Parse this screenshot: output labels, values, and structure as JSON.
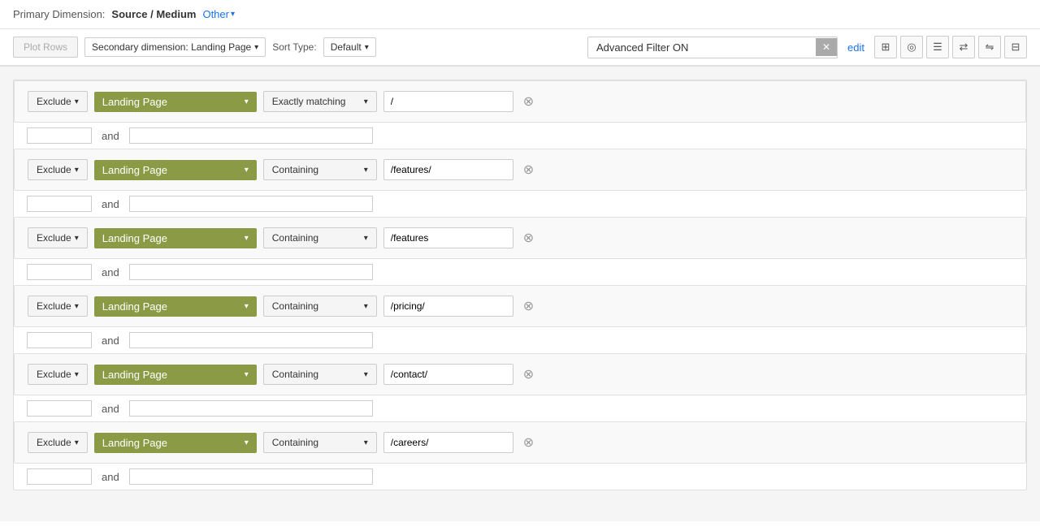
{
  "topBar": {
    "primaryDimensionLabel": "Primary Dimension:",
    "sourceMedium": "Source / Medium",
    "otherLabel": "Other",
    "chevron": "▾"
  },
  "toolbar": {
    "plotRowsLabel": "Plot Rows",
    "secondaryDimension": "Secondary dimension: Landing Page",
    "sortTypeLabel": "Sort Type:",
    "sortDefault": "Default",
    "filterValue": "Advanced Filter ON",
    "filterPlaceholder": "Advanced Filter ON",
    "editLabel": "edit",
    "chevron": "▾",
    "viewIcons": [
      "⊞",
      "◎",
      "☰",
      "⇄",
      "⇋",
      "⊟"
    ]
  },
  "filters": [
    {
      "excludeLabel": "Exclude",
      "dimension": "Landing Page",
      "matchType": "Exactly matching",
      "value": "/"
    },
    {
      "excludeLabel": "Exclude",
      "dimension": "Landing Page",
      "matchType": "Containing",
      "value": "/features/"
    },
    {
      "excludeLabel": "Exclude",
      "dimension": "Landing Page",
      "matchType": "Containing",
      "value": "/features"
    },
    {
      "excludeLabel": "Exclude",
      "dimension": "Landing Page",
      "matchType": "Containing",
      "value": "/pricing/"
    },
    {
      "excludeLabel": "Exclude",
      "dimension": "Landing Page",
      "matchType": "Containing",
      "value": "/contact/"
    },
    {
      "excludeLabel": "Exclude",
      "dimension": "Landing Page",
      "matchType": "Containing",
      "value": "/careers/"
    }
  ],
  "andLabel": "and",
  "colors": {
    "dimensionBg": "#8a9a45",
    "filterInputBorder": "#ccc"
  }
}
